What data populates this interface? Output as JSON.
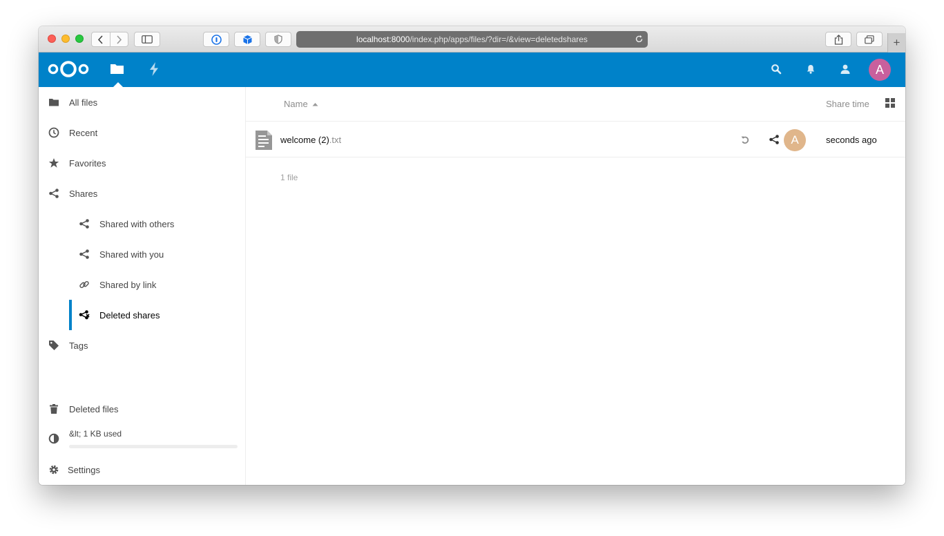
{
  "browser": {
    "url_host": "localhost:8000",
    "url_path": "/index.php/apps/files/?dir=/&view=deletedshares",
    "new_tab_label": "+"
  },
  "header": {
    "user_initial": "A",
    "brand_color": "#0082c9"
  },
  "sidebar": {
    "items": [
      {
        "label": "All files",
        "icon": "folder-icon"
      },
      {
        "label": "Recent",
        "icon": "clock-icon"
      },
      {
        "label": "Favorites",
        "icon": "star-icon"
      },
      {
        "label": "Shares",
        "icon": "share-icon"
      },
      {
        "label": "Shared with others",
        "icon": "share-icon"
      },
      {
        "label": "Shared with you",
        "icon": "share-icon"
      },
      {
        "label": "Shared by link",
        "icon": "link-icon"
      },
      {
        "label": "Deleted shares",
        "icon": "deleted-share-icon",
        "active": true
      },
      {
        "label": "Tags",
        "icon": "tag-icon"
      }
    ],
    "deleted_files_label": "Deleted files",
    "quota_text": "&lt; 1 KB used",
    "quota_fraction": 0.0,
    "settings_label": "Settings"
  },
  "file_list": {
    "columns": {
      "name": "Name",
      "share_time": "Share time"
    },
    "files": [
      {
        "basename": "welcome (2)",
        "extension": ".txt",
        "owner_initial": "A",
        "share_time": "seconds ago"
      }
    ],
    "summary": "1 file"
  }
}
